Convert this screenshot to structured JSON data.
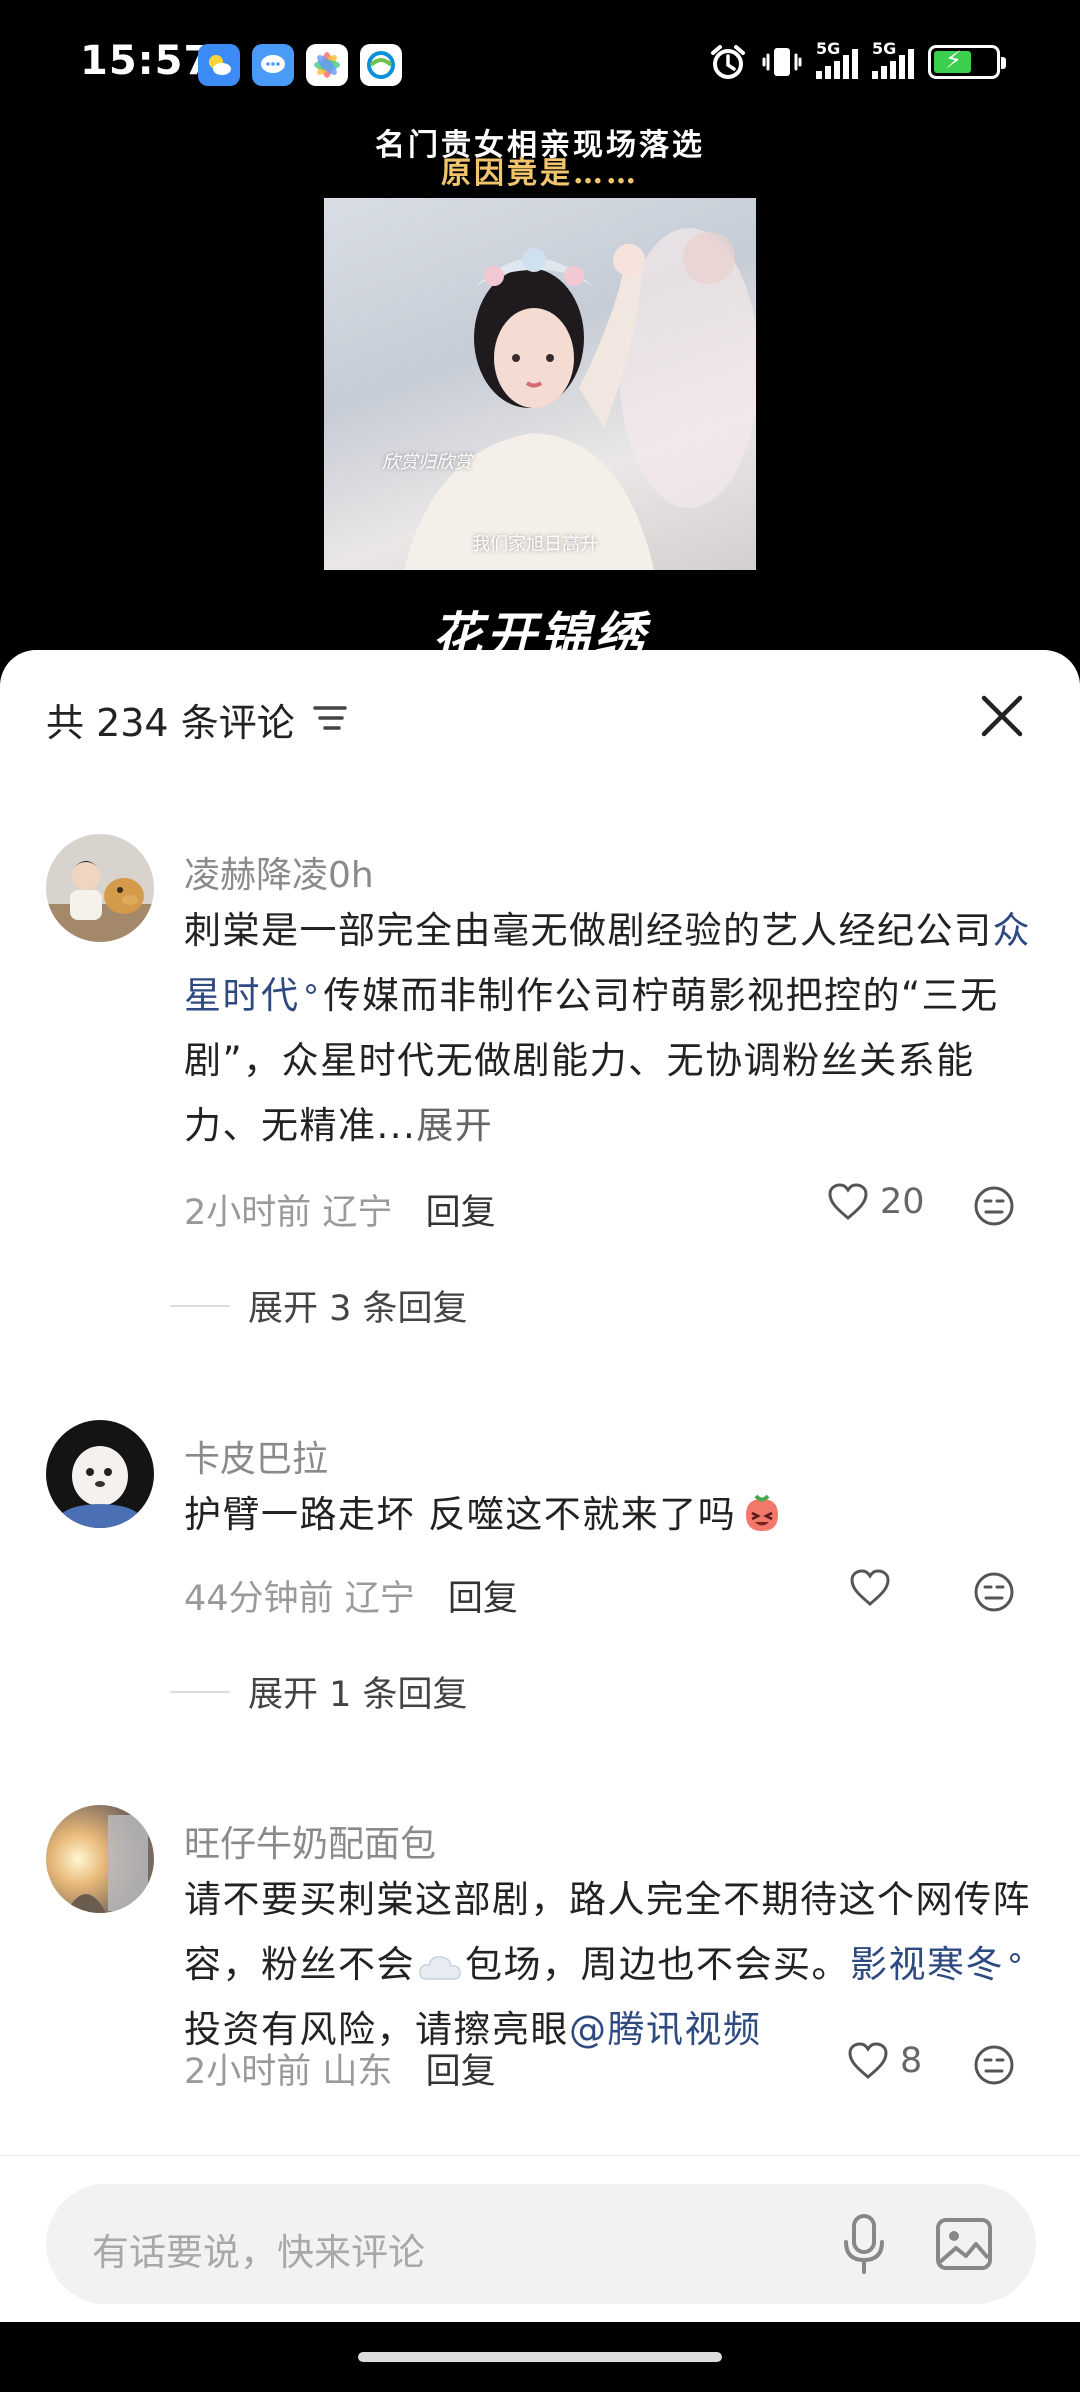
{
  "status_bar": {
    "time": "15:57",
    "network_1": "5G",
    "network_2": "5G"
  },
  "video": {
    "title_line1": "名门贵女相亲现场落选",
    "title_line2": "原因竟是……",
    "subtitle_1": "欣赏归欣赏",
    "subtitle_2": "我们家旭日高升",
    "logo_text": "花开锦绣"
  },
  "sheet": {
    "count_label": "共 234 条评论"
  },
  "comments": [
    {
      "user": "凌赫降凌0h",
      "text_a": "刺棠是一部完全由毫无做剧经验的艺人经纪公司",
      "link": "众星时代",
      "text_b": "传媒而非制作公司柠萌影视把控的“三无剧”，众星时代无做剧能力、无协调粉丝关系能力、无精准...",
      "more": "展开",
      "time": "2小时前",
      "location": "辽宁",
      "reply_label": "回复",
      "likes": "20",
      "expand_label": "展开 3 条回复"
    },
    {
      "user": "卡皮巴拉",
      "text": "护臂一路走坏 反噬这不就来了吗",
      "time": "44分钟前",
      "location": "辽宁",
      "reply_label": "回复",
      "likes": "",
      "expand_label": "展开 1 条回复"
    },
    {
      "user": "旺仔牛奶配面包",
      "text_a": "请不要买刺棠这部剧，路人完全不期待这个网传阵容，粉丝不会",
      "text_b": "包场，周边也不会买。",
      "link": "影视寒冬",
      "text_c": "投资有风险，请擦亮眼",
      "mention": "@腾讯视频",
      "time": "2小时前",
      "location": "山东",
      "reply_label": "回复",
      "likes": "8"
    }
  ],
  "input": {
    "placeholder": "有话要说，快来评论"
  },
  "icons": [
    "alarm-icon",
    "vibrate-icon",
    "filter-icon",
    "close-icon",
    "heart-icon",
    "dislike-face-icon",
    "mic-icon",
    "image-icon"
  ]
}
